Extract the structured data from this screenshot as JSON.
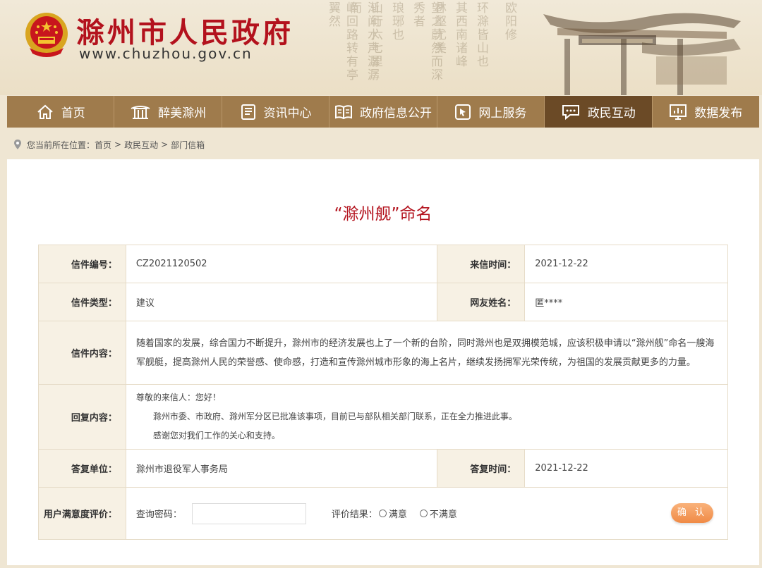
{
  "header": {
    "site_title": "滁州市人民政府",
    "site_url": "www.chuzhou.gov.cn"
  },
  "nav": [
    {
      "label": "首页",
      "icon": "home-icon"
    },
    {
      "label": "醉美滁州",
      "icon": "pavilion-icon"
    },
    {
      "label": "资讯中心",
      "icon": "news-icon"
    },
    {
      "label": "政府信息公开",
      "icon": "book-icon"
    },
    {
      "label": "网上服务",
      "icon": "pointer-icon"
    },
    {
      "label": "政民互动",
      "icon": "chat-icon",
      "active": true
    },
    {
      "label": "数据发布",
      "icon": "chart-icon"
    }
  ],
  "breadcrumb": {
    "prefix": "您当前所在位置：",
    "items": [
      "首页",
      "政民互动",
      "部门信箱"
    ],
    "sep": ">"
  },
  "letter": {
    "title": "“滁州舰”命名",
    "number_label": "信件编号：",
    "number": "CZ2021120502",
    "date_label": "来信时间：",
    "date": "2021-12-22",
    "type_label": "信件类型：",
    "type": "建议",
    "author_label": "网友姓名：",
    "author": "匿****",
    "content_label": "信件内容：",
    "content": "随着国家的发展，综合国力不断提升，滁州市的经济发展也上了一个新的台阶，同时滁州也是双拥模范城，应该积极申请以“滁州舰”命名一艘海军舰艇，提高滁州人民的荣誉感、使命感，打造和宣传滁州城市形象的海上名片，继续发扬拥军光荣传统，为祖国的发展贡献更多的力量。",
    "reply_label": "回复内容：",
    "reply_lines": [
      "尊敬的来信人：您好！",
      "滁州市委、市政府、滁州军分区已批准该事项，目前已与部队相关部门联系，正在全力推进此事。",
      "感谢您对我们工作的关心和支持。"
    ],
    "unit_label": "答复单位：",
    "unit": "滁州市退役军人事务局",
    "reply_date_label": "答复时间：",
    "reply_date": "2021-12-22"
  },
  "rating": {
    "label": "用户满意度评价：",
    "password_label": "查询密码：",
    "result_label": "评价结果：",
    "option_satisfied": "满意",
    "option_unsatisfied": "不满意",
    "confirm": "确 认"
  },
  "colors": {
    "brand_red": "#b3121d",
    "nav_bg": "#9f7b4c",
    "nav_active": "#6b4a26",
    "button_orange": "#f08a45"
  }
}
